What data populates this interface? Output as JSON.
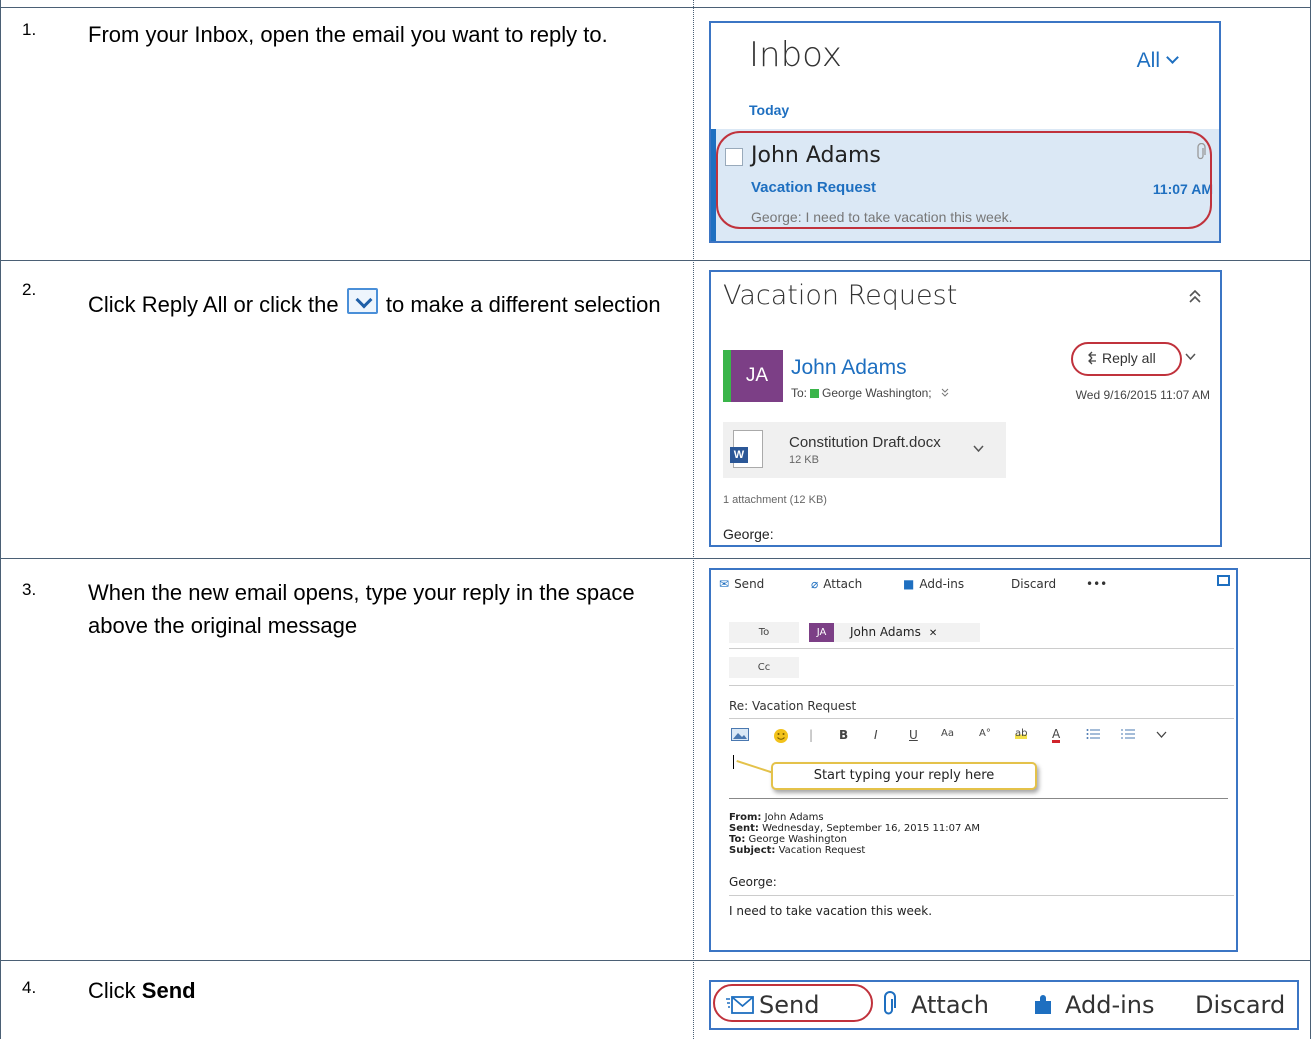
{
  "steps": [
    {
      "number": "1.",
      "text": "From your Inbox, open the email you want to reply to."
    },
    {
      "number": "2.",
      "text_before": "Click Reply All or click the",
      "text_after": "to make a different selection"
    },
    {
      "number": "3.",
      "text": "When the new email opens, type your reply in the space above the original message"
    },
    {
      "number": "4.",
      "text_prefix": "Click ",
      "text_bold": "Send"
    }
  ],
  "panel1": {
    "title": "Inbox",
    "filter": "All",
    "group": "Today",
    "sender": "John Adams",
    "subject": "Vacation Request",
    "time": "11:07 AM",
    "preview": "George:  I need to take vacation this week.",
    "attachment_icon": "paperclip-icon"
  },
  "panel2": {
    "title": "Vacation Request",
    "avatar_initials": "JA",
    "from": "John Adams",
    "to_prefix": "To:",
    "to_name": "George Washington;",
    "reply_label": "Reply all",
    "date": "Wed 9/16/2015 11:07 AM",
    "file_name": "Constitution Draft.docx",
    "file_size": "12 KB",
    "attachment_count": "1 attachment (12 KB)",
    "body_start": "George:"
  },
  "panel3": {
    "toolbar": {
      "send": "Send",
      "attach": "Attach",
      "addins": "Add-ins",
      "discard": "Discard",
      "more": "•••"
    },
    "to_label": "To",
    "recipient_initials": "JA",
    "recipient_name": "John Adams",
    "recipient_remove": "✕",
    "cc_label": "Cc",
    "subject": "Re: Vacation Request",
    "callout": "Start typing your reply here",
    "format_buttons": [
      "B",
      "I",
      "U",
      "Aa",
      "A°",
      "ab",
      "A"
    ],
    "header": {
      "from_label": "From:",
      "from_value": " John Adams",
      "sent_label": "Sent:",
      "sent_value": " Wednesday, September 16, 2015 11:07 AM",
      "to_label": "To:",
      "to_value": " George Washington",
      "subject_label": "Subject:",
      "subject_value": " Vacation Request"
    },
    "body_greeting": "George:",
    "body_text": "I need to take vacation this week."
  },
  "panel4": {
    "send": "Send",
    "attach": "Attach",
    "addins": "Add-ins",
    "discard": "Discard"
  }
}
